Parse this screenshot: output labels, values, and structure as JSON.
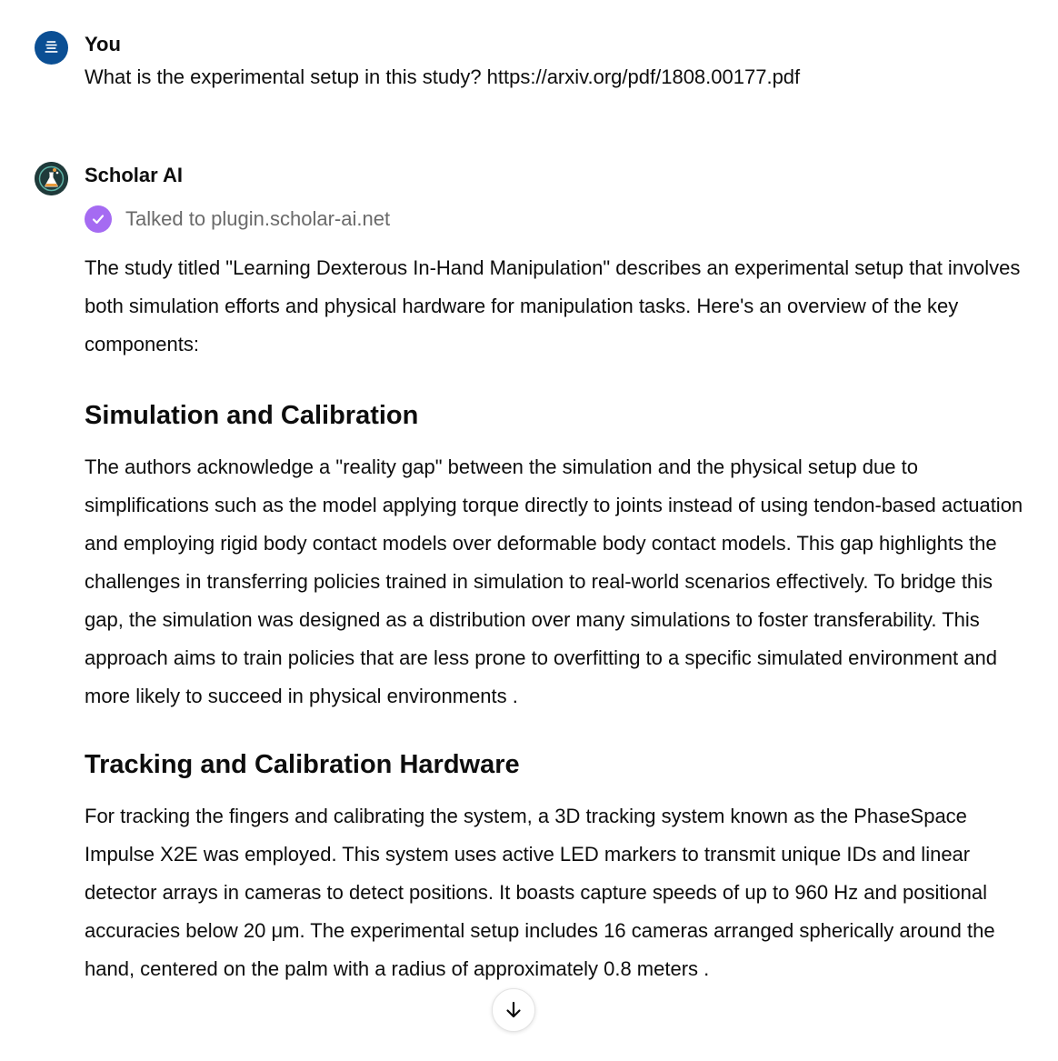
{
  "user_message": {
    "author": "You",
    "avatar_glyph": "亖",
    "avatar_color": "#0b4f94",
    "text": "What is the experimental setup in this study? https://arxiv.org/pdf/1808.00177.pdf"
  },
  "assistant_message": {
    "author": "Scholar AI",
    "avatar_icon": "flask-icon",
    "tool_call": {
      "icon": "check-icon",
      "color": "#a56bf2",
      "text": "Talked to plugin.scholar-ai.net"
    },
    "intro": "The study titled \"Learning Dexterous In-Hand Manipulation\" describes an experimental setup that involves both simulation efforts and physical hardware for manipulation tasks. Here's an overview of the key components:",
    "sections": [
      {
        "heading": "Simulation and Calibration",
        "body": "The authors acknowledge a \"reality gap\" between the simulation and the physical setup due to simplifications such as the model applying torque directly to joints instead of using tendon-based actuation and employing rigid body contact models over deformable body contact models. This gap highlights the challenges in transferring policies trained in simulation to real-world scenarios effectively. To bridge this gap, the simulation was designed as a distribution over many simulations to foster transferability. This approach aims to train policies that are less prone to overfitting to a specific simulated environment and more likely to succeed in physical environments ."
      },
      {
        "heading": "Tracking and Calibration Hardware",
        "body": "For tracking the fingers and calibrating the system, a 3D tracking system known as the PhaseSpace Impulse X2E was employed. This system uses active LED markers to transmit unique IDs and linear detector arrays in cameras to detect positions. It boasts capture speeds of up to 960 Hz and positional accuracies below 20 μm. The experimental setup includes 16 cameras arranged spherically around the hand, centered on the palm with a radius of approximately 0.8 meters ."
      }
    ]
  },
  "scroll_button": {
    "icon": "arrow-down-icon"
  }
}
